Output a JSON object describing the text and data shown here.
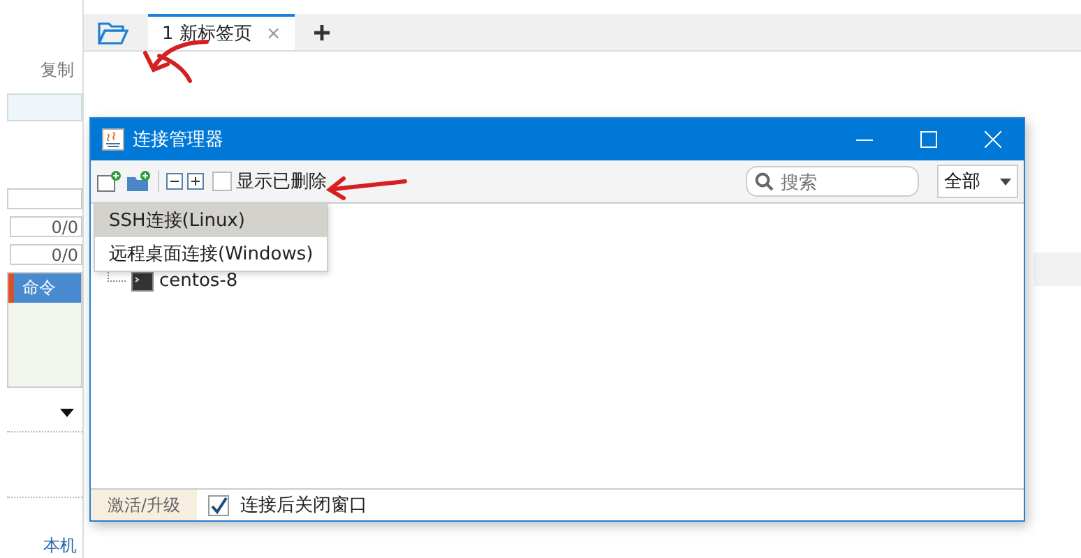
{
  "left_panel": {
    "copy_label": "复制",
    "counters": [
      "0/0",
      "0/0"
    ],
    "list": [
      {
        "label": "命令",
        "selected": true
      }
    ],
    "local_label": "本机"
  },
  "tabs": [
    {
      "label": "1 新标签页",
      "selected": true,
      "close": "×"
    }
  ],
  "dialog": {
    "title": "连接管理器",
    "toolbar": {
      "show_deleted": {
        "label": "显示已删除",
        "checked": false
      },
      "search": {
        "placeholder": "搜索"
      },
      "filter": {
        "value": "全部"
      }
    },
    "menu": [
      {
        "label": "SSH连接(Linux)",
        "selected": true
      },
      {
        "label": "远程桌面连接(Windows)",
        "selected": false
      }
    ],
    "tree": [
      {
        "label": "centos-8"
      }
    ],
    "status_bar": {
      "activate": "激活/升级",
      "close_after_connect": {
        "label": "连接后关闭窗口",
        "checked": true
      }
    }
  }
}
